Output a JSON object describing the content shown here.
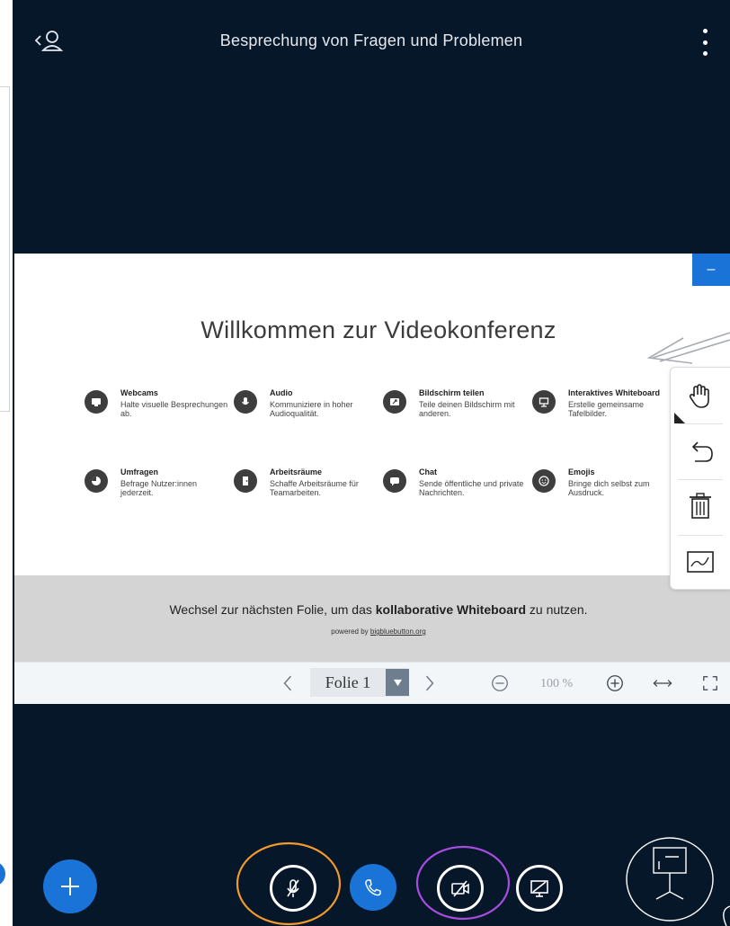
{
  "header": {
    "title": "Besprechung von Fragen und Problemen"
  },
  "slide": {
    "title": "Willkommen zur Videokonferenz",
    "features": [
      {
        "name": "Webcams",
        "desc": "Halte visuelle Besprechungen ab.",
        "icon": "webcam-icon"
      },
      {
        "name": "Audio",
        "desc": "Kommuniziere in hoher Audioqualität.",
        "icon": "microphone-icon"
      },
      {
        "name": "Bildschirm teilen",
        "desc": "Teile deinen Bildschirm mit anderen.",
        "icon": "screen-share-icon"
      },
      {
        "name": "Interaktives Whiteboard",
        "desc": "Erstelle gemeinsame Tafelbilder.",
        "icon": "whiteboard-icon"
      },
      {
        "name": "Umfragen",
        "desc": "Befrage Nutzer:innen jederzeit.",
        "icon": "poll-icon"
      },
      {
        "name": "Arbeitsräume",
        "desc": "Schaffe Arbeitsräume für Teamarbeiten.",
        "icon": "breakout-room-icon"
      },
      {
        "name": "Chat",
        "desc": "Sende öffentliche und private Nachrichten.",
        "icon": "chat-icon"
      },
      {
        "name": "Emojis",
        "desc": "Bringe dich selbst zum Ausdruck.",
        "icon": "emoji-icon"
      }
    ],
    "footer_prefix": "Wechsel zur nächsten Folie, um das ",
    "footer_bold": "kollaborative Whiteboard",
    "footer_suffix": " zu nutzen.",
    "powered_prefix": "powered by ",
    "powered_link": "bigbluebutton.org"
  },
  "toolbar": {
    "slide_label": "Folie 1",
    "zoom": "100 %"
  },
  "minimize_label": "–",
  "colors": {
    "background": "#06172a",
    "accent": "#1a74d8",
    "annotation_orange": "#f39a2c",
    "annotation_purple": "#a64de0"
  }
}
